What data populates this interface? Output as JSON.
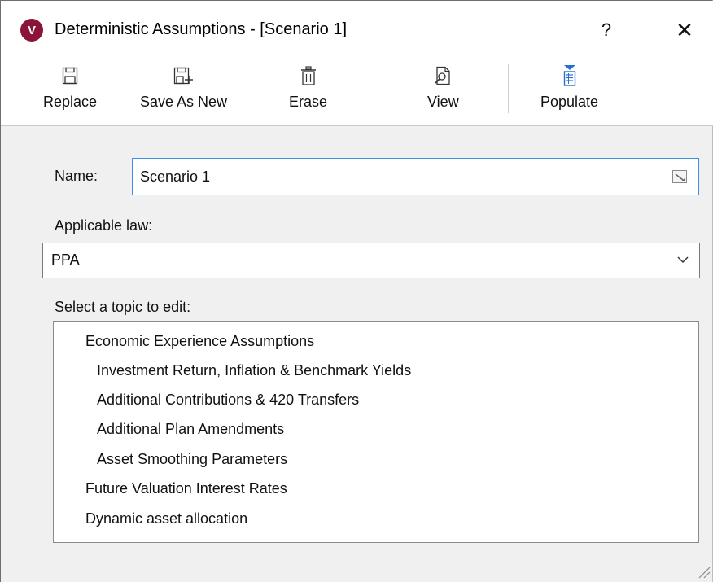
{
  "window": {
    "app_icon_letter": "V",
    "title": "Deterministic Assumptions - [Scenario 1]",
    "help_label": "?",
    "close_label": "✕"
  },
  "toolbar": {
    "replace_label": "Replace",
    "save_as_new_label": "Save As New",
    "erase_label": "Erase",
    "view_label": "View",
    "populate_label": "Populate"
  },
  "form": {
    "name_label": "Name:",
    "name_value": "Scenario 1",
    "applicable_law_label": "Applicable law:",
    "applicable_law_value": "PPA",
    "topic_label": "Select a topic to edit:"
  },
  "topics": [
    "Economic Experience Assumptions",
    "Investment Return, Inflation & Benchmark Yields",
    "Additional Contributions & 420 Transfers",
    "Additional Plan Amendments",
    "Asset Smoothing Parameters",
    "Future Valuation Interest Rates",
    "Dynamic asset allocation"
  ],
  "colors": {
    "app_icon": "#8a1538",
    "focus_border": "#3c8ee6",
    "populate_icon": "#2b6fce"
  }
}
